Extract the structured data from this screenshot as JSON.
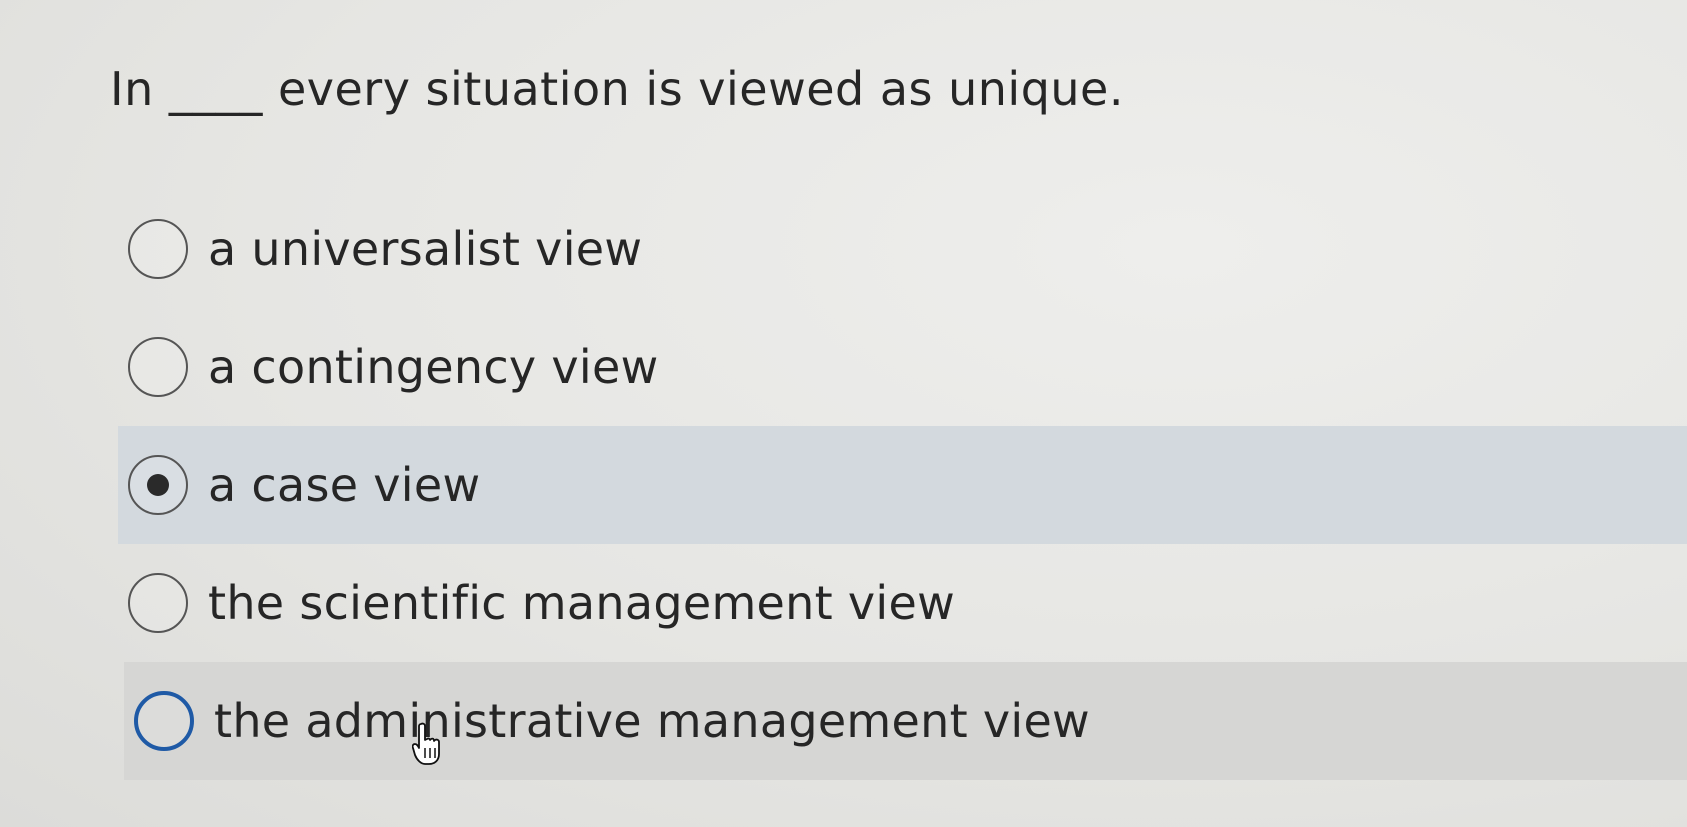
{
  "question": {
    "text": "In ____ every situation is viewed as unique."
  },
  "options": [
    {
      "label": "a universalist view",
      "selected": false
    },
    {
      "label": "a contingency view",
      "selected": false
    },
    {
      "label": "a case view",
      "selected": true
    },
    {
      "label": "the scientific management view",
      "selected": false
    },
    {
      "label": "the administrative management view",
      "selected": false,
      "hovered": true
    }
  ],
  "colors": {
    "selected_row": "#d3d9de",
    "hover_row": "#d6d6d4",
    "focus_ring": "#1f5aa6"
  },
  "icons": {
    "cursor": "hand-pointer-icon"
  }
}
